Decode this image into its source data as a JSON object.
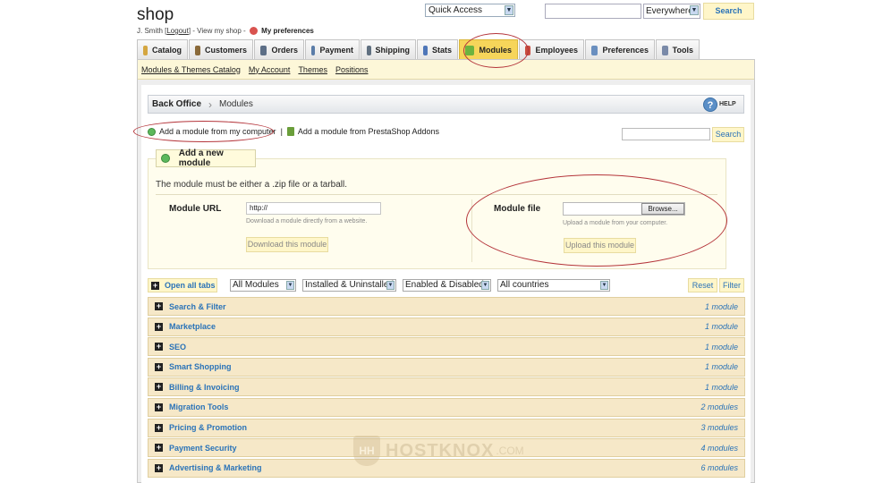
{
  "header": {
    "shop_title": "shop",
    "user": "J. Smith",
    "logout": "Logout",
    "view_shop": "View my shop",
    "preferences": "My preferences",
    "quick_access": "Quick Access",
    "search_scope": "Everywhere",
    "search_button": "Search"
  },
  "tabs": [
    {
      "label": "Catalog",
      "color": "#d4a640"
    },
    {
      "label": "Customers",
      "color": "#8a6a3a"
    },
    {
      "label": "Orders",
      "color": "#5c6e86"
    },
    {
      "label": "Payment",
      "color": "#5a7ca8"
    },
    {
      "label": "Shipping",
      "color": "#607080"
    },
    {
      "label": "Stats",
      "color": "#4e76b8"
    },
    {
      "label": "Modules",
      "color": "#6db33f"
    },
    {
      "label": "Employees",
      "color": "#c94d3f"
    },
    {
      "label": "Preferences",
      "color": "#6a8fbf"
    },
    {
      "label": "Tools",
      "color": "#7a8aa8"
    }
  ],
  "subnav": [
    "Modules & Themes Catalog",
    "My Account",
    "Themes",
    "Positions"
  ],
  "breadcrumb": {
    "root": "Back Office",
    "current": "Modules",
    "help": "HELP"
  },
  "add_links": {
    "from_computer": "Add a module from my computer",
    "from_addons": "Add a module from PrestaShop Addons",
    "search_button": "Search"
  },
  "add_form": {
    "legend": "Add a new module",
    "note": "The module must be either a .zip file or a tarball.",
    "url_label": "Module URL",
    "url_value": "http://",
    "url_hint": "Download a module directly from a website.",
    "download_button": "Download this module",
    "file_label": "Module file",
    "browse_button": "Browse...",
    "file_hint": "Upload a module from your computer.",
    "upload_button": "Upload this module"
  },
  "filters": {
    "open_all": "Open all tabs",
    "modules": "All Modules",
    "installed": "Installed & Uninstalled",
    "enabled": "Enabled & Disabled",
    "countries": "All countries",
    "reset": "Reset",
    "filter": "Filter"
  },
  "categories": [
    {
      "name": "Search & Filter",
      "count": "1 module"
    },
    {
      "name": "Marketplace",
      "count": "1 module"
    },
    {
      "name": "SEO",
      "count": "1 module"
    },
    {
      "name": "Smart Shopping",
      "count": "1 module"
    },
    {
      "name": "Billing & Invoicing",
      "count": "1 module"
    },
    {
      "name": "Migration Tools",
      "count": "2 modules"
    },
    {
      "name": "Pricing & Promotion",
      "count": "3 modules"
    },
    {
      "name": "Payment Security",
      "count": "4 modules"
    },
    {
      "name": "Advertising & Marketing",
      "count": "6 modules"
    }
  ],
  "watermark": {
    "badge": "HH",
    "text": "HOSTKNOX",
    "suffix": ".COM"
  }
}
